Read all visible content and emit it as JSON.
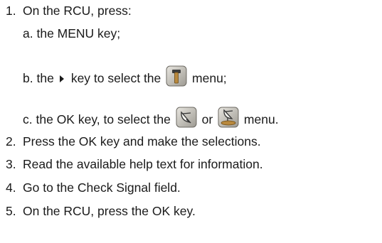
{
  "steps": [
    {
      "number": "1.",
      "text": "On the RCU, press:"
    },
    {
      "number": "2.",
      "text": "Press the OK key and make the selections."
    },
    {
      "number": "3.",
      "text": "Read the available help text for information."
    },
    {
      "number": "4.",
      "text": "Go to the Check Signal field."
    },
    {
      "number": "5.",
      "text": "On the RCU, press the OK key."
    }
  ],
  "substeps": {
    "a": {
      "letter": "a.",
      "text": "the MENU key;"
    },
    "b": {
      "letter": "b.",
      "before": "the",
      "middle": "key to select the",
      "after": "menu;"
    },
    "c": {
      "letter": "c.",
      "before": "the OK key, to select the",
      "or": "or",
      "after": "menu."
    }
  },
  "icons": {
    "triangle": "right-triangle-icon",
    "b": "hammer-settings-icon",
    "c1": "satellite-dish-icon",
    "c2": "satellite-dish-stand-icon"
  },
  "colors": {
    "text": "#1a1a1a",
    "icon_bg": "#c0bdb5",
    "icon_accent": "#b9893d"
  }
}
